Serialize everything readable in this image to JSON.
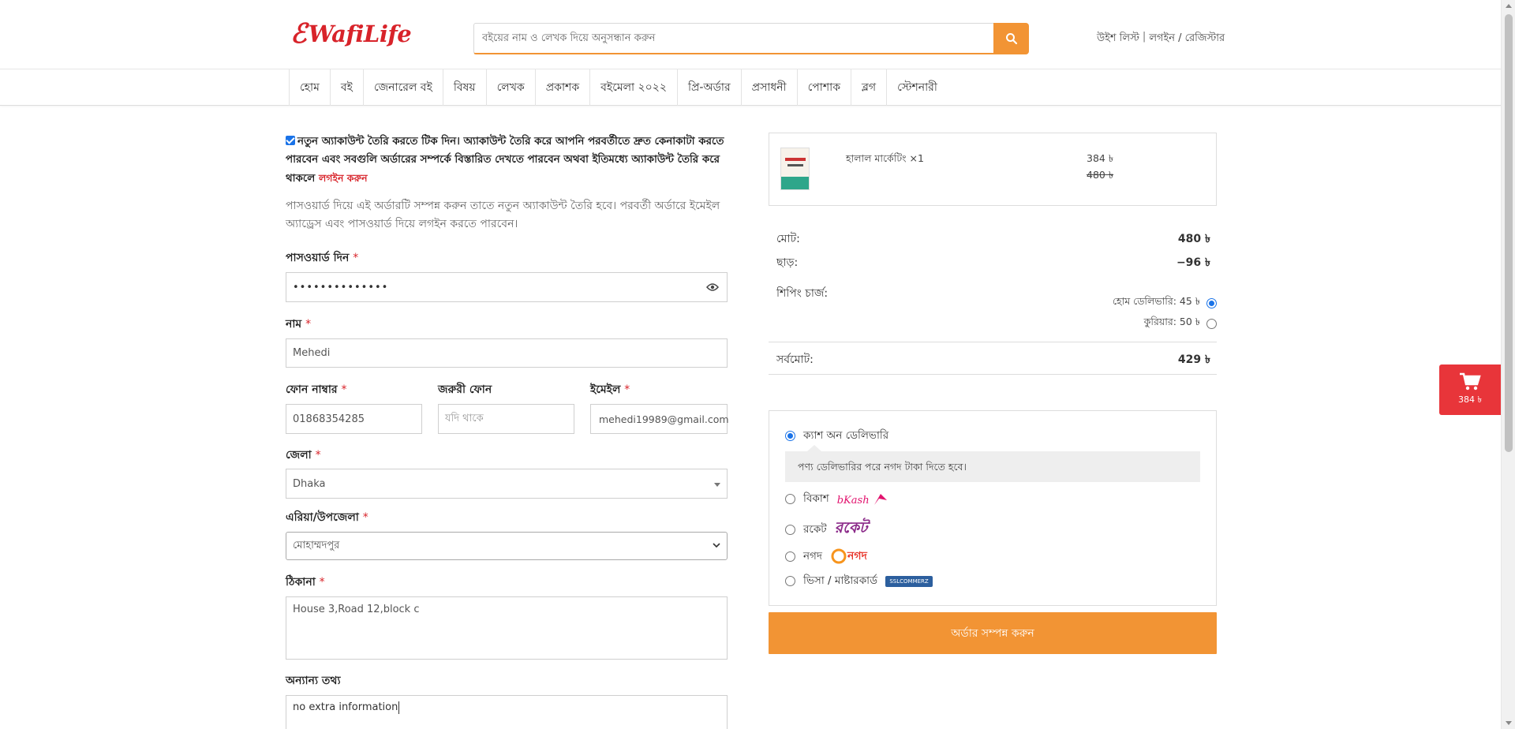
{
  "header": {
    "logo_mark": "ℰ",
    "logo_text": "WafiLife",
    "search_placeholder": "বইয়ের নাম ও লেখক দিয়ে অনুসন্ধান করুন",
    "wishlist": "উইশ লিস্ট",
    "login": "লগইন / রেজিস্টার",
    "separator": "|",
    "accent": "#f29434",
    "brand_color": "#d8232a"
  },
  "nav": {
    "items": [
      "হোম",
      "বই",
      "জেনারেল বই",
      "বিষয়",
      "লেখক",
      "প্রকাশক",
      "বইমেলা ২০২২",
      "প্রি-অর্ডার",
      "প্রসাধনী",
      "পোশাক",
      "ব্লগ",
      "স্টেশনারী"
    ]
  },
  "form": {
    "notice_text": "নতুন অ্যাকাউন্ট তৈরি করতে টিক দিন। অ্যাকাউন্ট তৈরি করে আপনি পরবর্তীতে দ্রুত কেনাকাটা করতে পারবেন এবং সবগুলি অর্ডারের সম্পর্কে বিস্তারিত দেখতে পারবেন অথবা ইতিমধ্যে অ্যাকাউন্ট তৈরি করে থাকলে",
    "notice_login": "লগইন করুন",
    "help_text": "পাসওয়ার্ড দিয়ে এই অর্ডারটি সম্পন্ন করুন তাতে নতুন অ্যাকাউন্ট তৈরি হবে। পরবর্তী অর্ডারে ইমেইল অ্যাড্রেস এবং পাসওয়ার্ড দিয়ে লগইন করতে পারবেন।",
    "password_label": "পাসওয়ার্ড দিন",
    "password_value": "••••••••••••••",
    "name_label": "নাম",
    "name_value": "Mehedi",
    "phone_label": "ফোন নাম্বার",
    "phone_value": "01868354285",
    "alt_phone_label": "জরুরী ফোন",
    "alt_phone_placeholder": "যদি থাকে",
    "email_label": "ইমেইল",
    "email_value": "mehedi19989@gmail.com",
    "district_label": "জেলা",
    "district_value": "Dhaka",
    "area_label": "এরিয়া/উপজেলা",
    "area_value": "মোহাম্মদপুর",
    "address_label": "ঠিকানা",
    "address_value": "House 3,Road 12,block c",
    "other_label": "অন্যান্য তথ্য",
    "other_value": "no extra information",
    "required_mark": "*"
  },
  "cart": {
    "item_name": "হালাল মার্কেটিং ×1",
    "price_new": "384 ৳",
    "price_old": "480 ৳"
  },
  "summary": {
    "total_label": "মোট:",
    "total_value": "480 ৳",
    "discount_label": "ছাড়:",
    "discount_value": "−96 ৳",
    "shipping_label": "শিপিং চার্জ:",
    "ship_home": "হোম ডেলিভারি: 45 ৳",
    "ship_courier": "কুরিয়ার: 50 ৳",
    "grand_label": "সর্বমোট:",
    "grand_value": "429 ৳"
  },
  "payment": {
    "cod": "ক্যাশ অন ডেলিভারি",
    "cod_note": "পণ্য ডেলিভারির পরে নগদ টাকা দিতে হবে।",
    "bkash": "বিকাশ",
    "bkash_brand": "bKash",
    "rocket": "রকেট",
    "rocket_brand": "রকেট",
    "nagad": "নগদ",
    "nagad_brand": "নগদ",
    "card": "ভিসা / মাষ্টারকার্ড",
    "card_brand": "SSLCOMMERZ"
  },
  "submit_label": "অর্ডার সম্পন্ন করুন",
  "float_cart": {
    "amount": "384 ৳"
  }
}
